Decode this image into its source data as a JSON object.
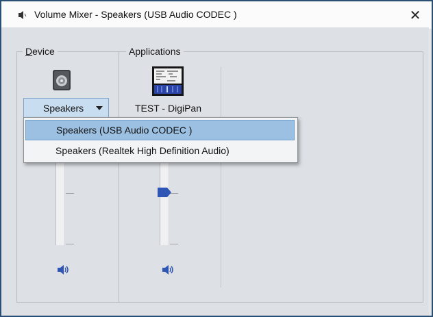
{
  "window": {
    "title": "Volume Mixer - Speakers (USB Audio CODEC )",
    "close_glyph": "✕"
  },
  "device": {
    "group_label_prefix": "D",
    "group_label_rest": "evice",
    "icon": "speaker-device-icon",
    "selected_label": "Speakers",
    "mute_icon": "speaker-volume-icon"
  },
  "applications": {
    "group_label": "Applications",
    "app_name": "TEST - DigiPan",
    "icon": "app-window-icon",
    "mute_icon": "speaker-volume-icon"
  },
  "dropdown": {
    "options": [
      "Speakers (USB Audio CODEC )",
      "Speakers (Realtek High Definition Audio)"
    ],
    "selected_index": 0
  },
  "colors": {
    "selection": "#9cc0e2",
    "slider_thumb": "#2f55b5",
    "window_border": "#2a4f73"
  }
}
